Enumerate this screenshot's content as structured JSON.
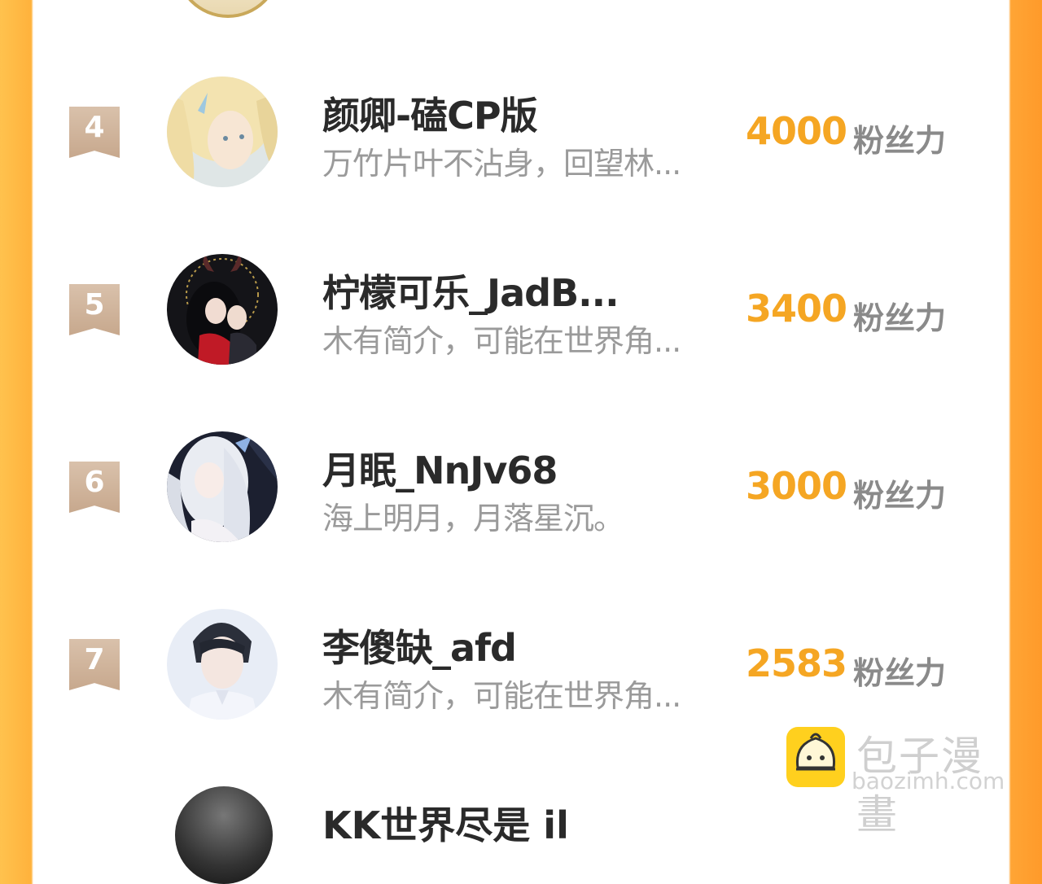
{
  "rows": [
    {
      "rank": "4",
      "name": "颜卿-磕CP版",
      "bio": "万竹片叶不沾身，回望林...",
      "score": "4000",
      "unit": "粉丝力",
      "avatar": "blonde-elf-avatar"
    },
    {
      "rank": "5",
      "name": "柠檬可乐_JadB...",
      "bio": "木有简介，可能在世界角...",
      "score": "3400",
      "unit": "粉丝力",
      "avatar": "demon-couple-avatar"
    },
    {
      "rank": "6",
      "name": "月眠_NnJv68",
      "bio": "海上明月，月落星沉。",
      "score": "3000",
      "unit": "粉丝力",
      "avatar": "silver-hair-girl-avatar"
    },
    {
      "rank": "7",
      "name": "李傻缺_afd",
      "bio": "木有简介，可能在世界角...",
      "score": "2583",
      "unit": "粉丝力",
      "avatar": "dark-hair-boy-avatar"
    }
  ],
  "partial_row": {
    "name": "KK世界尽是 il"
  },
  "watermark": {
    "brand": "包子漫畫",
    "url": "baozimh.com",
    "icon": "bun-face-icon"
  },
  "colors": {
    "accent": "#f5a623",
    "flag": "#c7a88d",
    "border": "#ffa535"
  }
}
